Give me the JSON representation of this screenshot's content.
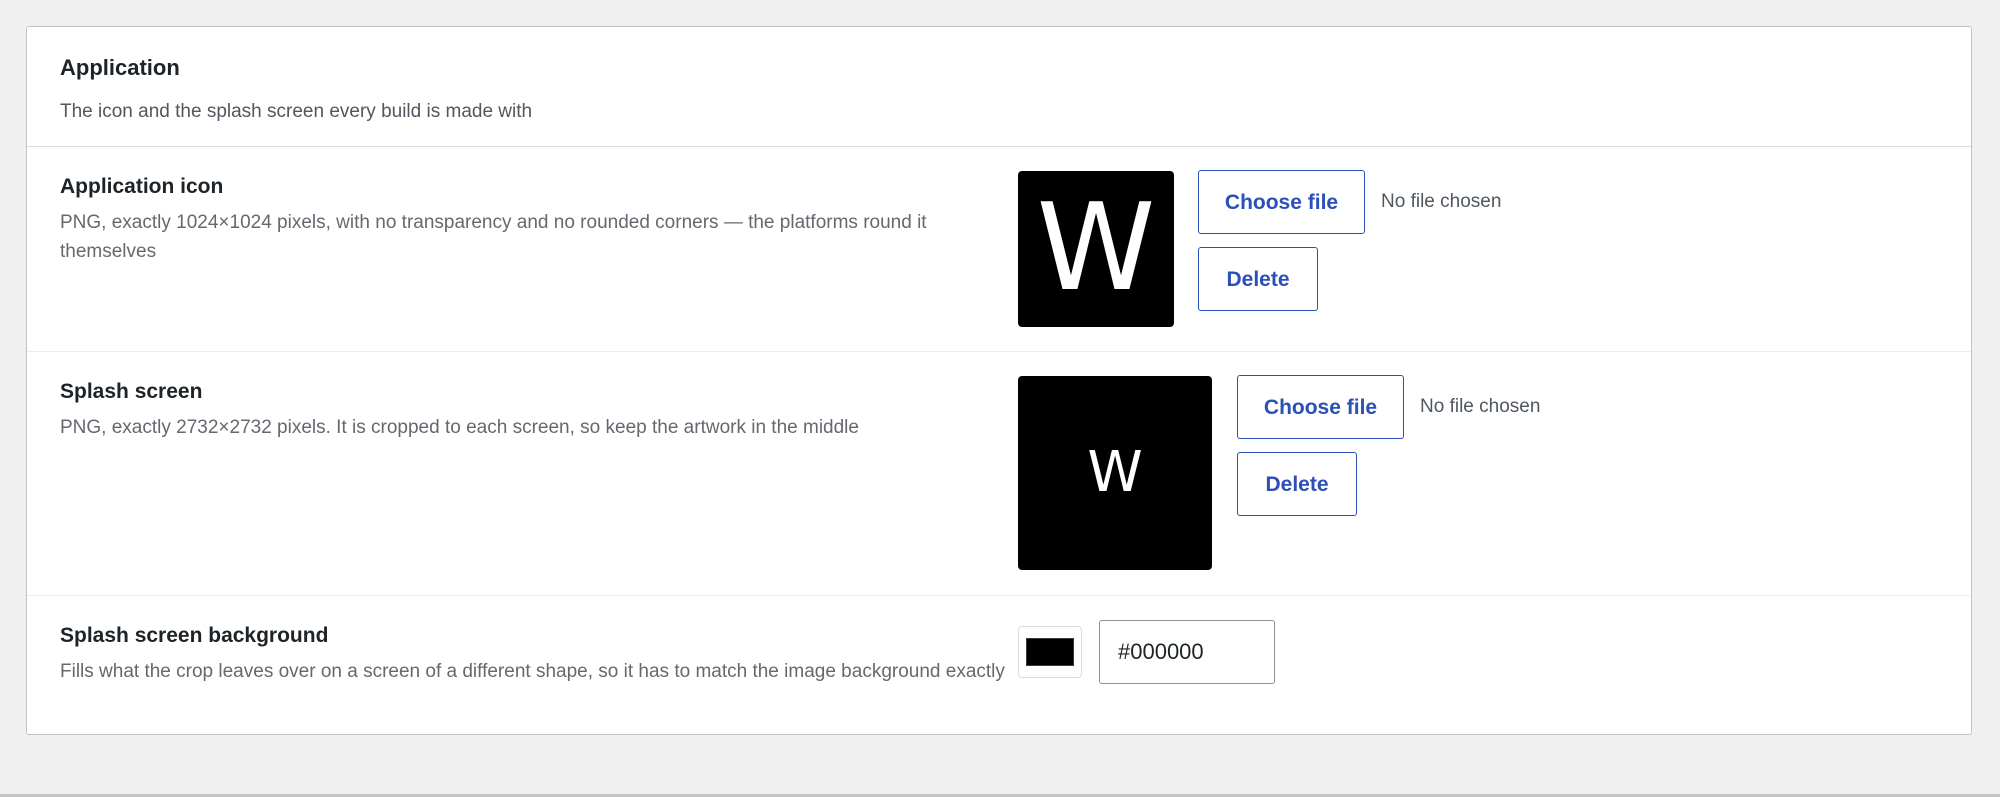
{
  "section": {
    "title": "Application",
    "subtitle": "The icon and the splash screen every build is made with"
  },
  "rows": {
    "icon": {
      "label": "Application icon",
      "description": "PNG, exactly 1024×1024 pixels, with no transparency and no rounded corners — the platforms round it themselves",
      "preview_letter": "W",
      "choose_label": "Choose file",
      "no_file": "No file chosen",
      "delete_label": "Delete"
    },
    "splash": {
      "label": "Splash screen",
      "description": "PNG, exactly 2732×2732 pixels. It is cropped to each screen, so keep the artwork in the middle",
      "preview_letter": "W",
      "choose_label": "Choose file",
      "no_file": "No file chosen",
      "delete_label": "Delete"
    },
    "background": {
      "label": "Splash screen background",
      "description": "Fills what the crop leaves over on a screen of a different shape, so it has to match the image background exactly",
      "color_value": "#000000"
    }
  },
  "colors": {
    "accent": "#2c4fb8",
    "page_background": "#f0f0f1",
    "preview_background": "#000000"
  }
}
